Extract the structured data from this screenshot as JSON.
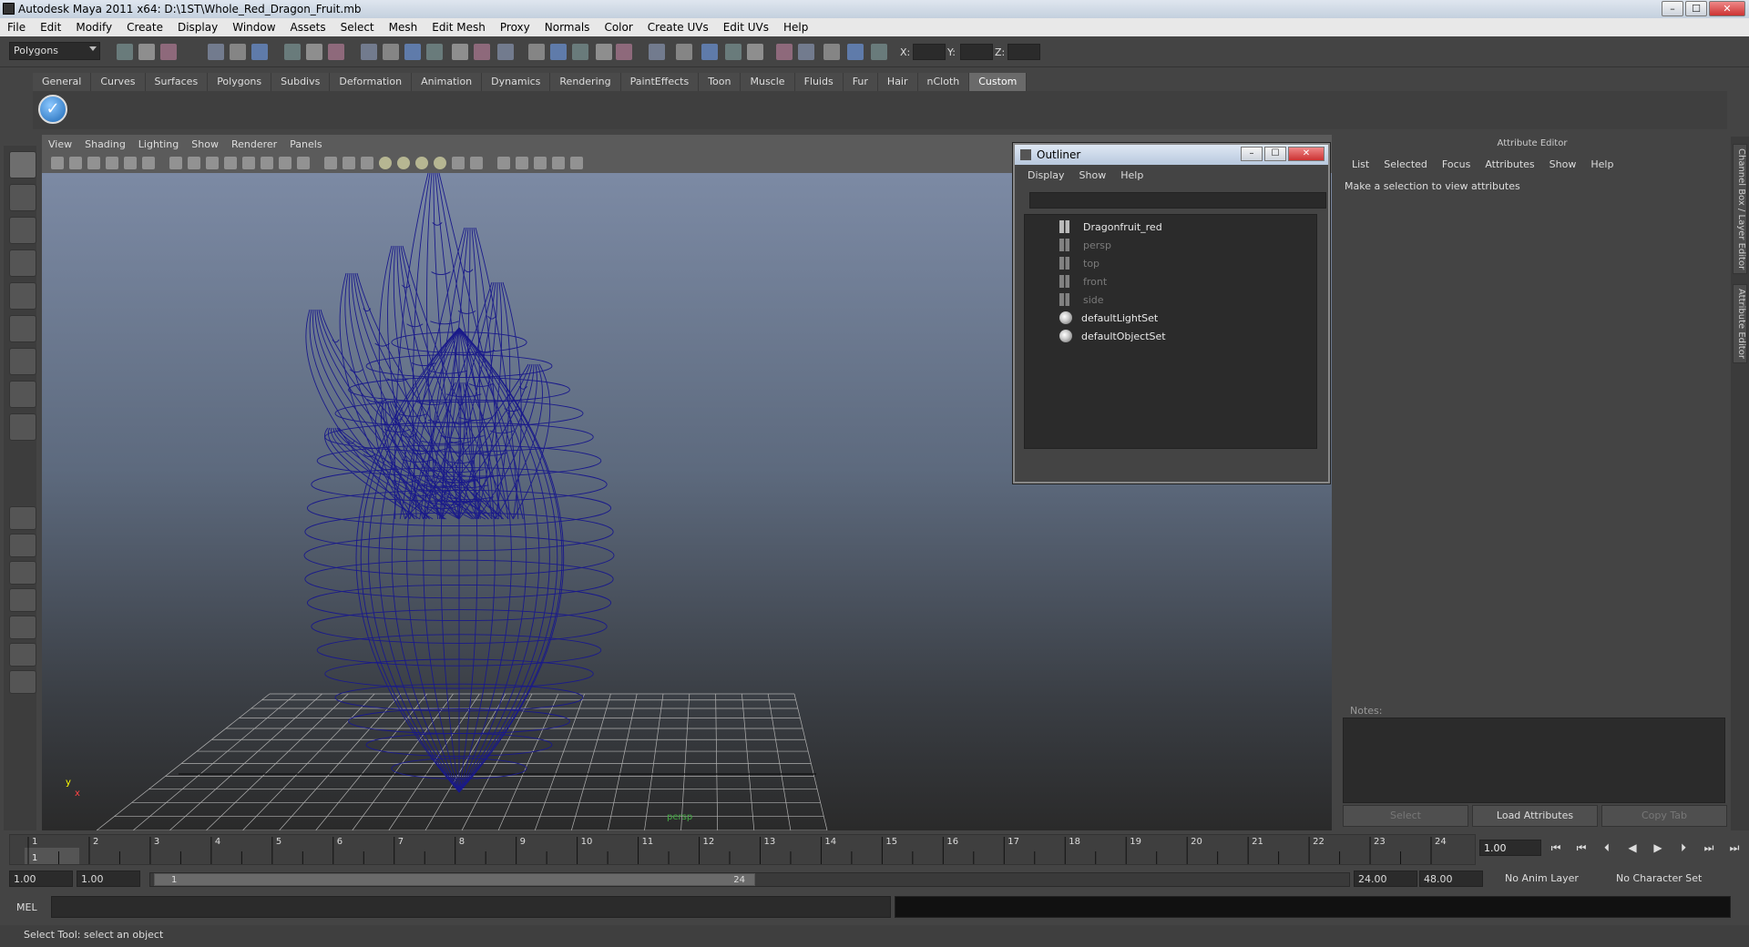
{
  "window": {
    "title": "Autodesk Maya 2011 x64: D:\\1ST\\Whole_Red_Dragon_Fruit.mb",
    "buttons": {
      "minimize": "–",
      "maximize": "☐",
      "close": "✕"
    }
  },
  "menubar": [
    "File",
    "Edit",
    "Modify",
    "Create",
    "Display",
    "Window",
    "Assets",
    "Select",
    "Mesh",
    "Edit Mesh",
    "Proxy",
    "Normals",
    "Color",
    "Create UVs",
    "Edit UVs",
    "Help"
  ],
  "statusline": {
    "mode": "Polygons",
    "x_label": "X:",
    "y_label": "Y:",
    "z_label": "Z:"
  },
  "shelf": {
    "tabs": [
      "General",
      "Curves",
      "Surfaces",
      "Polygons",
      "Subdivs",
      "Deformation",
      "Animation",
      "Dynamics",
      "Rendering",
      "PaintEffects",
      "Toon",
      "Muscle",
      "Fluids",
      "Fur",
      "Hair",
      "nCloth",
      "Custom"
    ],
    "active": "Custom",
    "button_glyph": "✓"
  },
  "viewport": {
    "menu": [
      "View",
      "Shading",
      "Lighting",
      "Show",
      "Renderer",
      "Panels"
    ],
    "camera_label": "persp",
    "axis": {
      "y": "y",
      "x": "x"
    }
  },
  "outliner": {
    "title": "Outliner",
    "menu": [
      "Display",
      "Show",
      "Help"
    ],
    "items": [
      {
        "label": "Dragonfruit_red",
        "icon": "mesh-icon",
        "dim": false
      },
      {
        "label": "persp",
        "icon": "camera-icon",
        "dim": true
      },
      {
        "label": "top",
        "icon": "camera-icon",
        "dim": true
      },
      {
        "label": "front",
        "icon": "camera-icon",
        "dim": true
      },
      {
        "label": "side",
        "icon": "camera-icon",
        "dim": true
      },
      {
        "label": "defaultLightSet",
        "icon": "set-icon",
        "dim": false
      },
      {
        "label": "defaultObjectSet",
        "icon": "set-icon",
        "dim": false
      }
    ]
  },
  "attribute_editor": {
    "title": "Attribute Editor",
    "menu": [
      "List",
      "Selected",
      "Focus",
      "Attributes",
      "Show",
      "Help"
    ],
    "message": "Make a selection to view attributes",
    "notes_label": "Notes:",
    "buttons": {
      "select": "Select",
      "load": "Load Attributes",
      "copy": "Copy Tab"
    }
  },
  "side_tabs": [
    "Channel Box / Layer Editor",
    "Attribute Editor"
  ],
  "timeline": {
    "ticks": [
      "1",
      "2",
      "3",
      "4",
      "5",
      "6",
      "7",
      "8",
      "9",
      "10",
      "11",
      "12",
      "13",
      "14",
      "15",
      "16",
      "17",
      "18",
      "19",
      "20",
      "21",
      "22",
      "23",
      "24"
    ],
    "current_marker": "1",
    "current_time": "1.00"
  },
  "range": {
    "start": "1.00",
    "playback_start": "1.00",
    "handle_start": "1",
    "handle_end": "24",
    "playback_end": "24.00",
    "end": "48.00",
    "anim_layer": "No Anim Layer",
    "char_set": "No Character Set"
  },
  "command_line": {
    "label": "MEL"
  },
  "help_line": "Select Tool: select an object",
  "colors": {
    "wireframe": "#1a1a8a",
    "grid": "#b0b0b0",
    "viewport_top": "#7c8aa4",
    "viewport_bottom": "#2a2a2a"
  }
}
